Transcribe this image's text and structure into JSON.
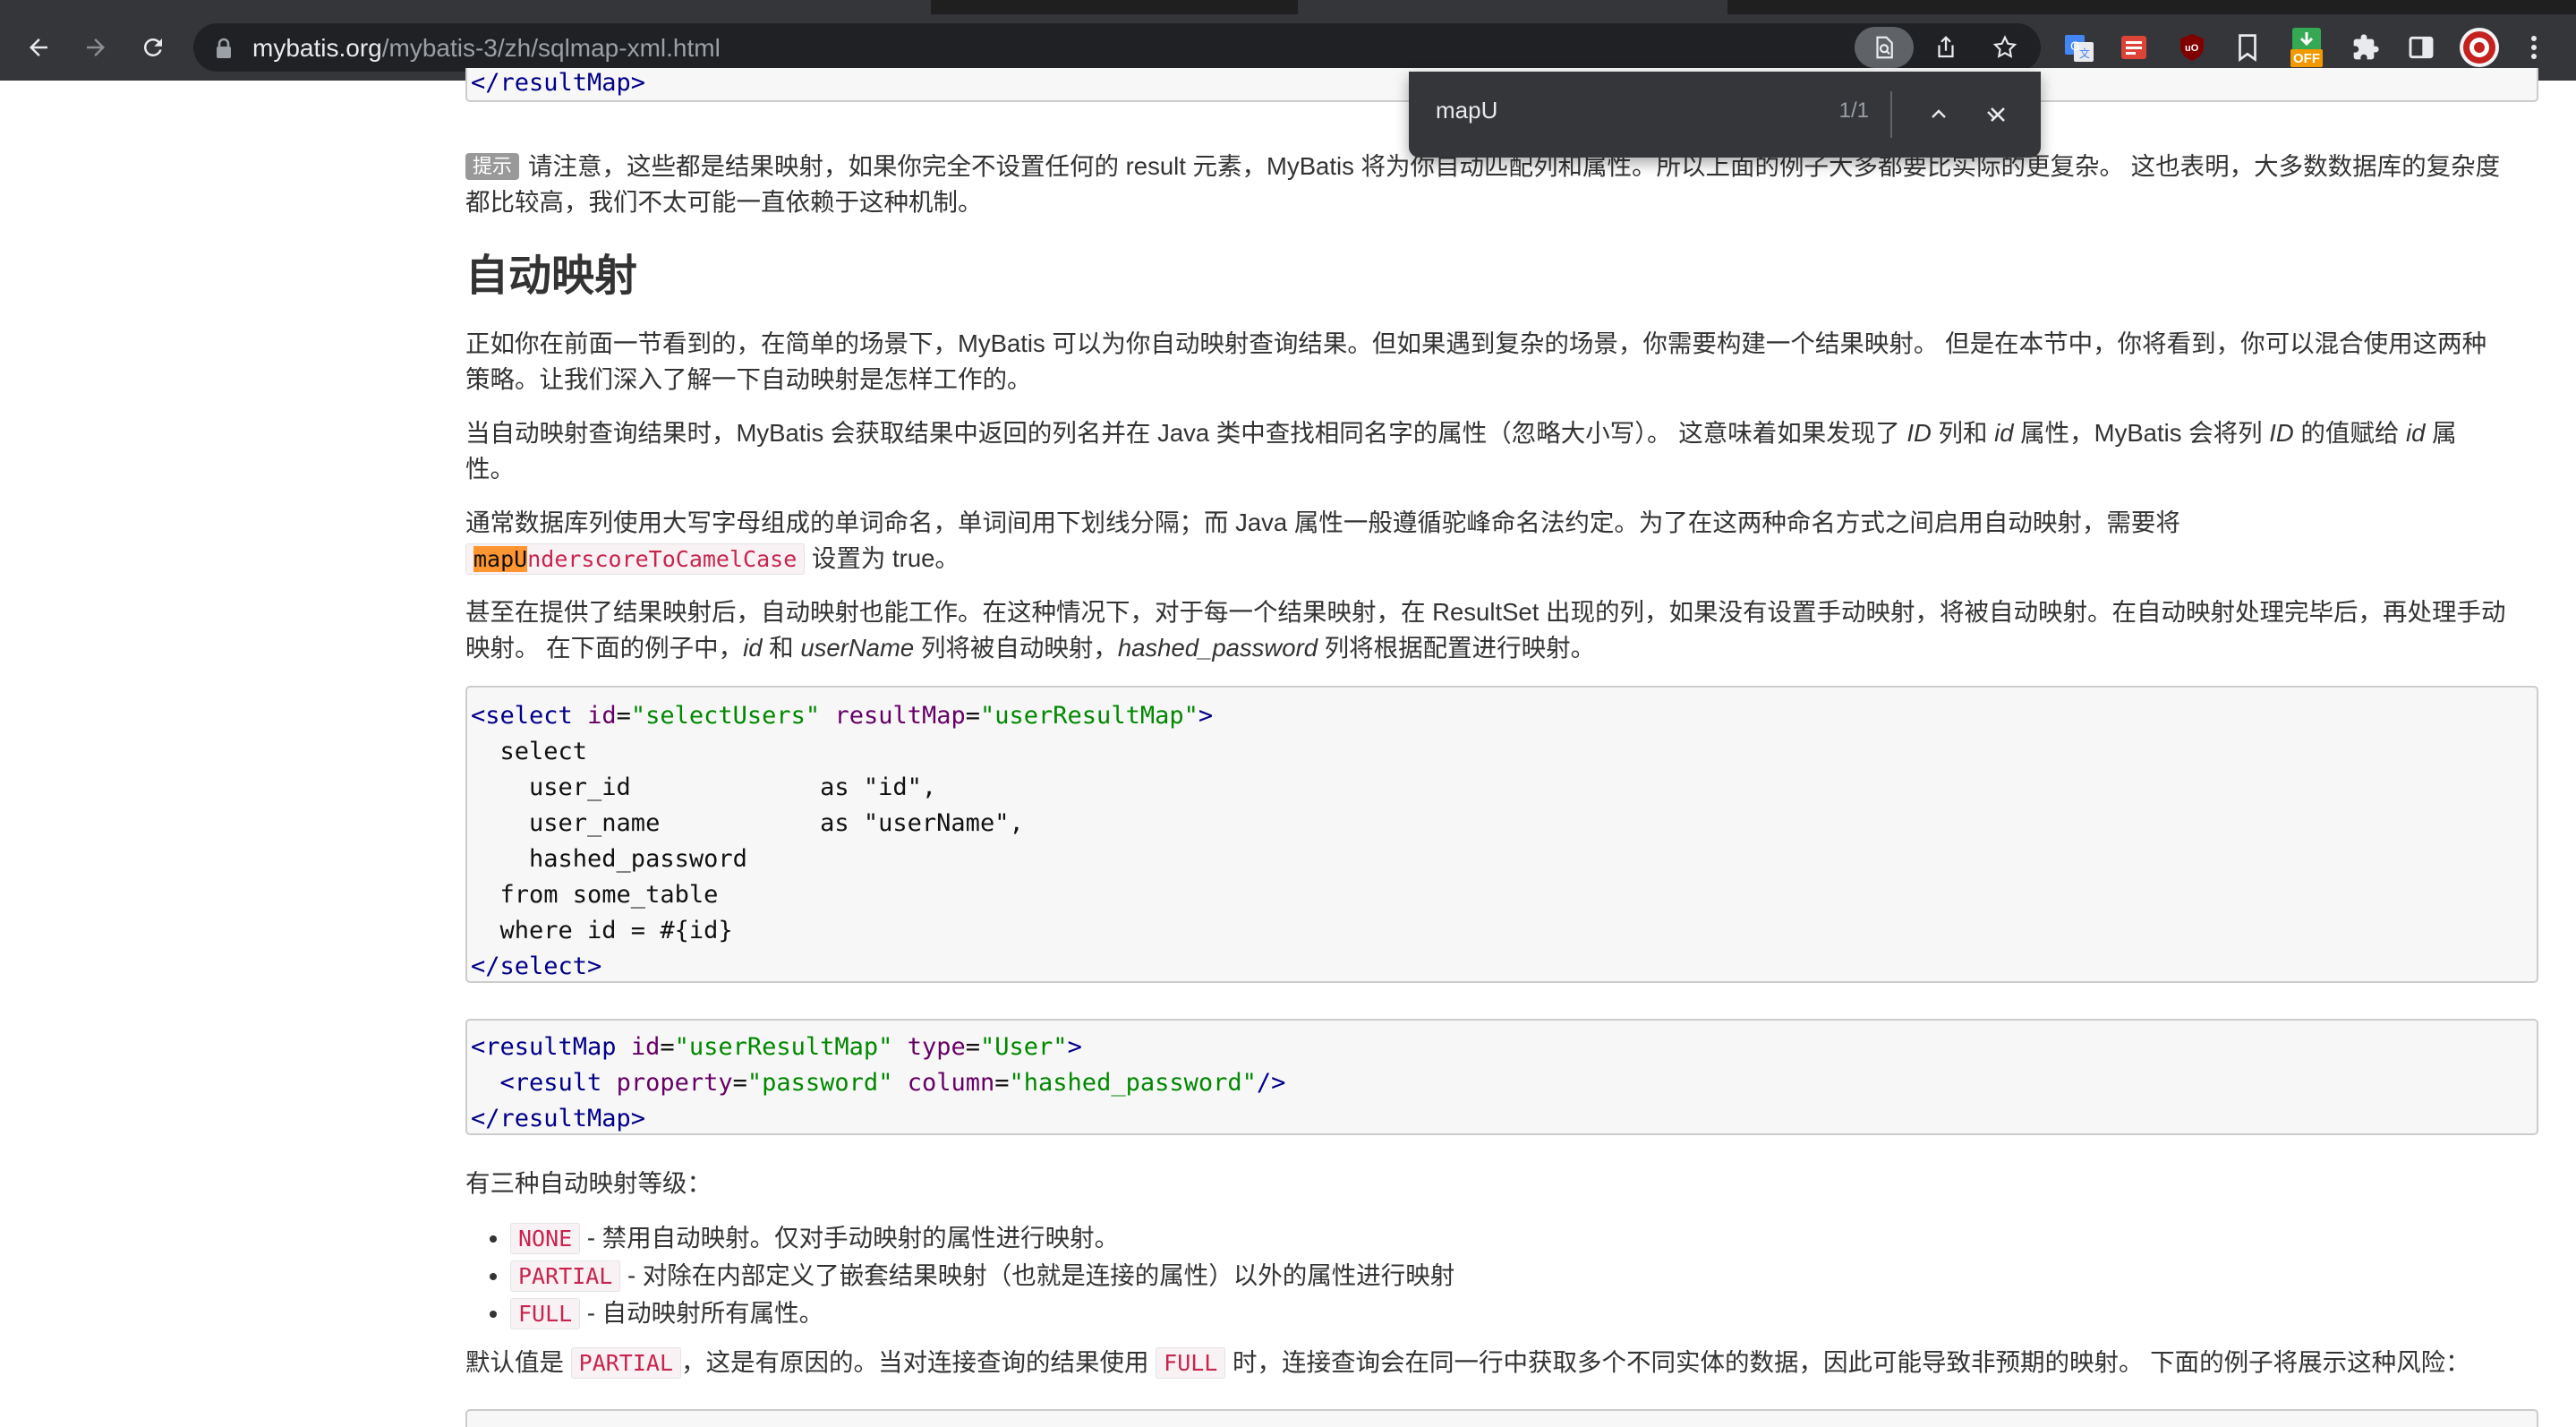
{
  "browser": {
    "url_host": "mybatis.org",
    "url_path": "/mybatis-3/zh/sqlmap-xml.html",
    "extension_badge": "OFF"
  },
  "find_bar": {
    "query": "mapU",
    "count": "1/1"
  },
  "page": {
    "prev_code_closing": "</resultMap>",
    "tip_badge": "提示",
    "tip_lines": [
      "请注意，这些都是结果映射，如果你完全不设置任何的 result 元素，MyBatis 将为你自动匹配列和属性。所以上面的例子大多都要比实际的更复杂。 这也表明，大多数数据库的复杂度",
      "都比较高，我们不太可能一直依赖于这种机制。"
    ],
    "heading": "自动映射",
    "para1": [
      "正如你在前面一节看到的，在简单的场景下，MyBatis 可以为你自动映射查询结果。但如果遇到复杂的场景，你需要构建一个结果映射。 但是在本节中，你将看到，你可以混合使用这两种",
      "策略。让我们深入了解一下自动映射是怎样工作的。"
    ],
    "para2": {
      "line1_a": "当自动映射查询结果时，MyBatis 会获取结果中返回的列名并在 Java 类中查找相同名字的属性（忽略大小写）。 这意味着如果发现了 ",
      "em_id_col": "ID",
      "line1_b": " 列和 ",
      "em_id_prop": "id",
      "line1_c": " 属性，MyBatis 会将列 ",
      "em_id_col2": "ID",
      "line1_d": " 的值赋给 ",
      "em_id_prop2": "id",
      "line1_e": " 属",
      "line2": "性。"
    },
    "para3": {
      "line1": "通常数据库列使用大写字母组成的单词命名，单词间用下划线分隔；而 Java 属性一般遵循驼峰命名法约定。为了在这两种命名方式之间启用自动映射，需要将",
      "code_highlight": "mapU",
      "code_rest": "nderscoreToCamelCase",
      "line2_suffix": " 设置为 true。"
    },
    "para4": {
      "line1": "甚至在提供了结果映射后，自动映射也能工作。在这种情况下，对于每一个结果映射，在 ResultSet 出现的列，如果没有设置手动映射，将被自动映射。在自动映射处理完毕后，再处理手动",
      "line2_a": "映射。 在下面的例子中，",
      "em_id": "id",
      "line2_b": " 和 ",
      "em_username": "userName",
      "line2_c": " 列将被自动映射，",
      "em_hashed": "hashed_password",
      "line2_d": " 列将根据配置进行映射。"
    },
    "code1": {
      "open_tag": "<select",
      "attr1_name": "id",
      "attr1_val": "\"selectUsers\"",
      "attr2_name": "resultMap",
      "attr2_val": "\"userResultMap\"",
      "open_close": ">",
      "lines": [
        "  select",
        "    user_id             as \"id\",",
        "    user_name           as \"userName\",",
        "    hashed_password",
        "  from some_table",
        "  where id = #{id}"
      ],
      "close_tag": "</select>"
    },
    "code2": {
      "open_tag": "<resultMap",
      "attr1_name": "id",
      "attr1_val": "\"userResultMap\"",
      "attr2_name": "type",
      "attr2_val": "\"User\"",
      "open_close": ">",
      "inner_tag": "<result",
      "inner_attr1_name": "property",
      "inner_attr1_val": "\"password\"",
      "inner_attr2_name": "column",
      "inner_attr2_val": "\"hashed_password\"",
      "inner_close": "/>",
      "close_tag": "</resultMap>"
    },
    "levels_intro": "有三种自动映射等级：",
    "levels": [
      {
        "code": "NONE",
        "text": " - 禁用自动映射。仅对手动映射的属性进行映射。"
      },
      {
        "code": "PARTIAL",
        "text": " - 对除在内部定义了嵌套结果映射（也就是连接的属性）以外的属性进行映射"
      },
      {
        "code": "FULL",
        "text": " - 自动映射所有属性。"
      }
    ],
    "default_para": {
      "a": "默认值是 ",
      "code1": "PARTIAL",
      "b": "，这是有原因的。当对连接查询的结果使用 ",
      "code2": "FULL",
      "c": " 时，连接查询会在同一行中获取多个不同实体的数据，因此可能导致非预期的映射。 下面的例子将展示这种风险："
    }
  }
}
